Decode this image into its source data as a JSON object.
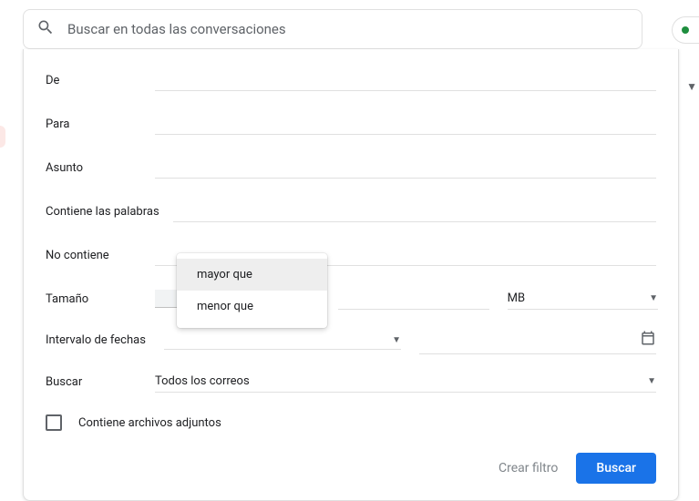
{
  "search": {
    "placeholder": "Buscar en todas las conversaciones"
  },
  "panel": {
    "from_label": "De",
    "to_label": "Para",
    "subject_label": "Asunto",
    "has_words_label": "Contiene las palabras",
    "no_words_label": "No contiene",
    "size_label": "Tamaño",
    "size_op": "",
    "size_unit": "MB",
    "date_label": "Intervalo de fechas",
    "search_in_label": "Buscar",
    "search_in_value": "Todos los correos",
    "attach_label": "Contiene archivos adjuntos",
    "create_filter": "Crear filtro",
    "search_btn": "Buscar"
  },
  "size_menu": {
    "greater": "mayor que",
    "less": "menor que"
  }
}
